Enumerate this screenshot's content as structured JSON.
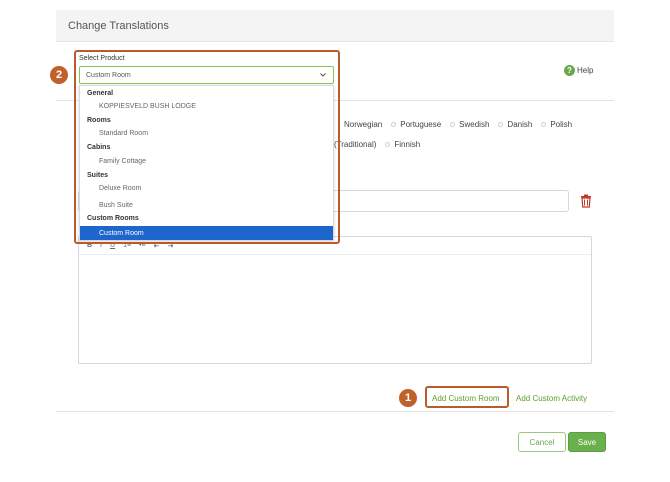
{
  "header": {
    "title": "Change Translations"
  },
  "help": {
    "label": "Help",
    "icon": "?"
  },
  "languages_row1": [
    "Norwegian",
    "Portuguese",
    "Swedish",
    "Danish",
    "Polish"
  ],
  "languages_row2": [
    "(Traditional)",
    "Finnish"
  ],
  "select": {
    "label": "Select Product",
    "value": "Custom Room",
    "groups": [
      {
        "name": "General",
        "items": [
          "KOPPIESVELD BUSH LODGE"
        ]
      },
      {
        "name": "Rooms",
        "items": [
          "Standard Room"
        ]
      },
      {
        "name": "Cabins",
        "items": [
          "Family Cottage"
        ]
      },
      {
        "name": "Suites",
        "items": [
          "Deluxe Room",
          "Bush Suite"
        ]
      },
      {
        "name": "Custom Rooms",
        "items": [
          "Custom Room"
        ]
      }
    ]
  },
  "toolbar": {
    "bold": "B",
    "italic": "I",
    "underline": "U",
    "ol": "1≡",
    "ul": "•≡",
    "outdent": "⇤",
    "indent": "⇥"
  },
  "links": {
    "add_custom_room": "Add Custom Room",
    "add_custom_activity": "Add Custom Activity"
  },
  "buttons": {
    "cancel": "Cancel",
    "save": "Save"
  },
  "callouts": {
    "one": "1",
    "two": "2"
  },
  "colors": {
    "accent_green": "#6ab04c",
    "callout": "#c0612b",
    "selected_blue": "#1f66cc"
  }
}
